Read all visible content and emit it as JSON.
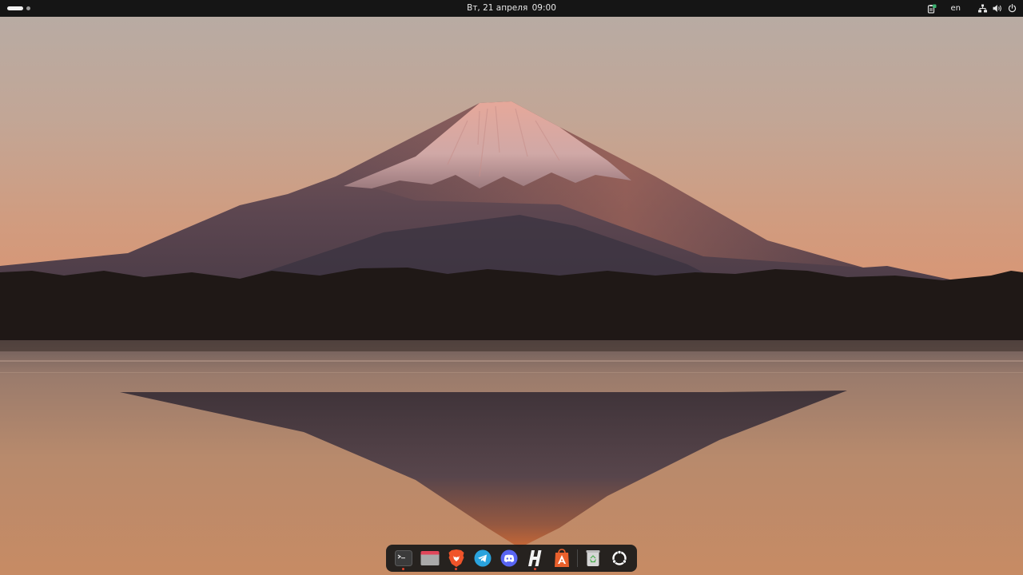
{
  "topbar": {
    "workspaces": {
      "count": 2,
      "active": 1
    },
    "clock": {
      "date": "Вт, 21 апреля",
      "time": "09:00"
    },
    "tray": {
      "app_indicator_icon": "clipboard-indicator-icon",
      "language": "en",
      "network_icon": "wired-network-icon",
      "volume_icon": "speaker-volume-icon",
      "power_icon": "power-icon"
    }
  },
  "wallpaper": {
    "subject": "mountain-lake-sunset-wallpaper"
  },
  "dock": {
    "running_indicator_color": "#e0452f",
    "items": [
      {
        "id": "terminal",
        "icon": "terminal-icon",
        "running": true
      },
      {
        "id": "files",
        "icon": "files-folder-icon",
        "running": false
      },
      {
        "id": "brave",
        "icon": "brave-lion-icon",
        "running": true
      },
      {
        "id": "telegram",
        "icon": "telegram-plane-icon",
        "running": false
      },
      {
        "id": "discord",
        "icon": "discord-icon",
        "running": false
      },
      {
        "id": "hedgedoc",
        "icon": "h-letter-icon",
        "running": true
      },
      {
        "id": "app-store",
        "icon": "app-center-icon",
        "running": false
      },
      {
        "id": "trash",
        "icon": "trash-icon",
        "running": false
      },
      {
        "id": "app-grid",
        "icon": "show-apps-icon",
        "running": false
      }
    ]
  },
  "colors": {
    "panel": "#151515",
    "dock": "#1a1a1a",
    "brave": "#f0542a",
    "telegram": "#2aa3dd",
    "discord": "#5865f2",
    "app_store": "#e9602c"
  }
}
